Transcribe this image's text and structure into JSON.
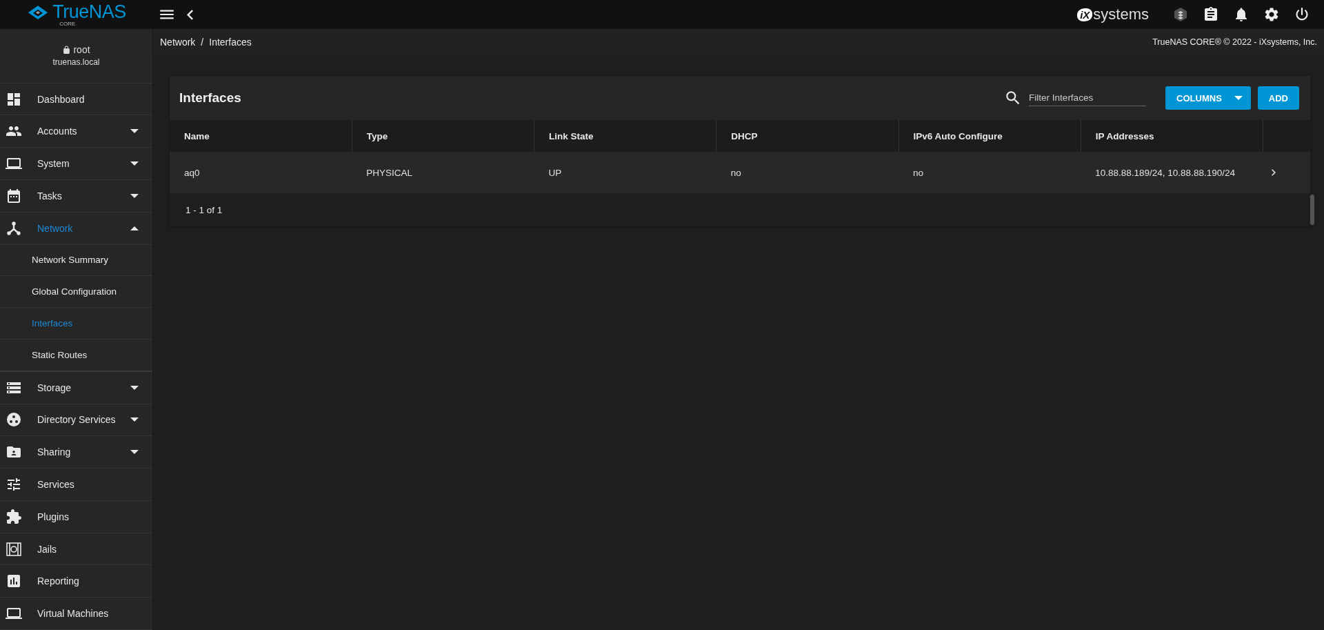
{
  "topbar": {
    "logo": {
      "text": "TrueNAS",
      "sub": "CORE"
    },
    "vendor": {
      "mark": "iX",
      "text": "systems"
    }
  },
  "user": {
    "name": "root",
    "host": "truenas.local"
  },
  "sidebar": {
    "items": [
      {
        "label": "Dashboard",
        "selected": false
      },
      {
        "label": "Accounts",
        "selected": false,
        "expanded": false
      },
      {
        "label": "System",
        "selected": false,
        "expanded": false
      },
      {
        "label": "Tasks",
        "selected": false,
        "expanded": false
      },
      {
        "label": "Network",
        "selected": true,
        "expanded": true,
        "children": [
          {
            "label": "Network Summary",
            "selected": false
          },
          {
            "label": "Global Configuration",
            "selected": false
          },
          {
            "label": "Interfaces",
            "selected": true
          },
          {
            "label": "Static Routes",
            "selected": false
          }
        ]
      },
      {
        "label": "Storage",
        "selected": false,
        "expanded": false
      },
      {
        "label": "Directory Services",
        "selected": false,
        "expanded": false
      },
      {
        "label": "Sharing",
        "selected": false,
        "expanded": false
      },
      {
        "label": "Services",
        "selected": false
      },
      {
        "label": "Plugins",
        "selected": false
      },
      {
        "label": "Jails",
        "selected": false
      },
      {
        "label": "Reporting",
        "selected": false
      },
      {
        "label": "Virtual Machines",
        "selected": false
      }
    ]
  },
  "breadcrumb": {
    "items": [
      "Network",
      "Interfaces"
    ],
    "separator": "/"
  },
  "copyright": "TrueNAS CORE® © 2022 - iXsystems, Inc.",
  "card": {
    "title": "Interfaces",
    "filter": {
      "placeholder": "Filter Interfaces"
    },
    "buttons": [
      {
        "label": "COLUMNS",
        "kind": "dropdown"
      },
      {
        "label": "ADD",
        "kind": "plain"
      }
    ]
  },
  "table": {
    "columns": [
      "Name",
      "Type",
      "Link State",
      "DHCP",
      "IPv6 Auto Configure",
      "IP Addresses"
    ],
    "rows": [
      {
        "cells": [
          "aq0",
          "PHYSICAL",
          "UP",
          "no",
          "no",
          "10.88.88.189/24, 10.88.88.190/24"
        ]
      }
    ],
    "footer": "1 - 1 of 1"
  }
}
